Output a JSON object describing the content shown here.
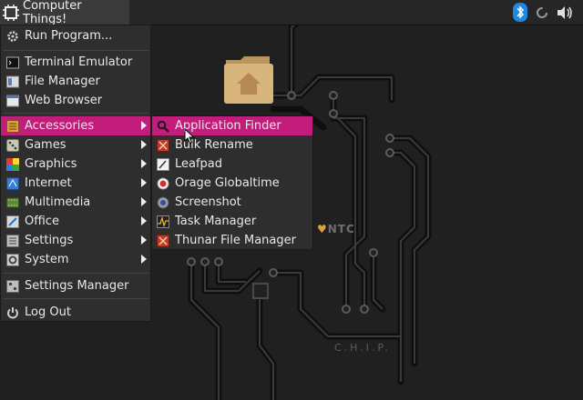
{
  "panel": {
    "start_label": "Computer Things!"
  },
  "menu": {
    "items": [
      {
        "label": "Run Program...",
        "icon": "gear-icon"
      },
      {
        "label": "Terminal Emulator",
        "icon": "terminal-icon"
      },
      {
        "label": "File Manager",
        "icon": "file-manager-icon"
      },
      {
        "label": "Web Browser",
        "icon": "web-browser-icon"
      },
      {
        "label": "Accessories",
        "icon": "accessories-icon"
      },
      {
        "label": "Games",
        "icon": "games-icon"
      },
      {
        "label": "Graphics",
        "icon": "graphics-icon"
      },
      {
        "label": "Internet",
        "icon": "internet-icon"
      },
      {
        "label": "Multimedia",
        "icon": "multimedia-icon"
      },
      {
        "label": "Office",
        "icon": "office-icon"
      },
      {
        "label": "Settings",
        "icon": "settings-icon"
      },
      {
        "label": "System",
        "icon": "system-icon"
      },
      {
        "label": "Settings Manager",
        "icon": "settings-manager-icon"
      },
      {
        "label": "Log Out",
        "icon": "log-out-icon"
      }
    ]
  },
  "submenu": {
    "items": [
      {
        "label": "Application Finder",
        "icon": "magnifier-icon"
      },
      {
        "label": "Bulk Rename",
        "icon": "bulk-rename-icon"
      },
      {
        "label": "Leafpad",
        "icon": "leafpad-icon"
      },
      {
        "label": "Orage Globaltime",
        "icon": "clock-icon"
      },
      {
        "label": "Screenshot",
        "icon": "screenshot-icon"
      },
      {
        "label": "Task Manager",
        "icon": "task-manager-icon"
      },
      {
        "label": "Thunar File Manager",
        "icon": "thunar-icon"
      }
    ]
  },
  "desktop": {
    "brand_text": "NTC",
    "chip_text": "C.H.I.P."
  },
  "colors": {
    "highlight": "#c21d7a",
    "menu_bg": "#2e2e2e",
    "bluetooth": "#1e88e5"
  }
}
